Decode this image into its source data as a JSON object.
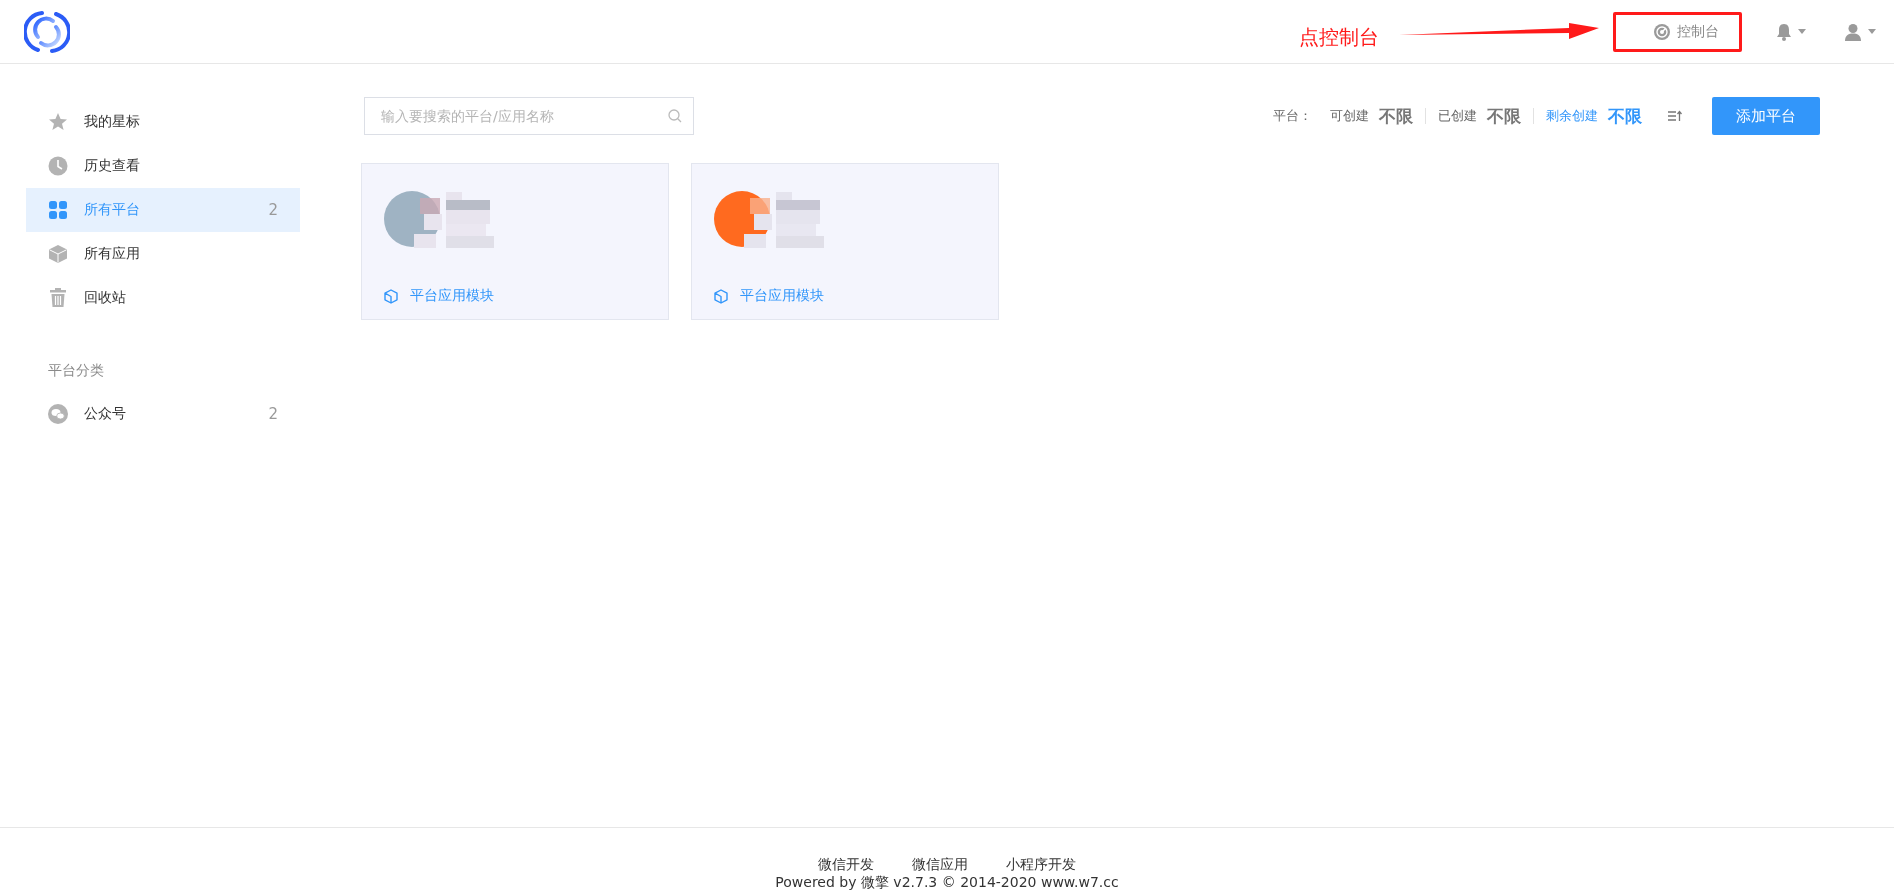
{
  "header": {
    "annotation": {
      "text": "点控制台"
    },
    "console_link": {
      "label": "控制台",
      "highlighted": true
    }
  },
  "sidebar": {
    "items": [
      {
        "label": "我的星标",
        "kind": "star",
        "selected": false
      },
      {
        "label": "历史查看",
        "kind": "clock",
        "selected": false
      },
      {
        "label": "所有平台",
        "kind": "grid",
        "count": "2",
        "selected": true
      },
      {
        "label": "所有应用",
        "kind": "cube",
        "selected": false
      },
      {
        "label": "回收站",
        "kind": "trash",
        "selected": false
      }
    ],
    "section_title": "平台分类",
    "categories": [
      {
        "label": "公众号",
        "kind": "wechat",
        "count": "2",
        "selected": false
      }
    ]
  },
  "search": {
    "placeholder": "输入要搜索的平台/应用名称"
  },
  "stats": {
    "label": "平台：",
    "items": [
      {
        "label": "可创建",
        "value": "不限",
        "kind": "plain"
      },
      {
        "label": "已创建",
        "value": "不限",
        "kind": "plain"
      },
      {
        "label": "剩余创建",
        "value": "不限",
        "kind": "accent"
      }
    ]
  },
  "add_button": "添加平台",
  "cards": [
    {
      "link": "平台应用模块"
    },
    {
      "link": "平台应用模块"
    }
  ],
  "footer": {
    "links": [
      "微信开发",
      "微信应用",
      "小程序开发"
    ],
    "copyright": "Powered by 微擎 v2.7.3 © 2014-2020 www.w7.cc"
  }
}
